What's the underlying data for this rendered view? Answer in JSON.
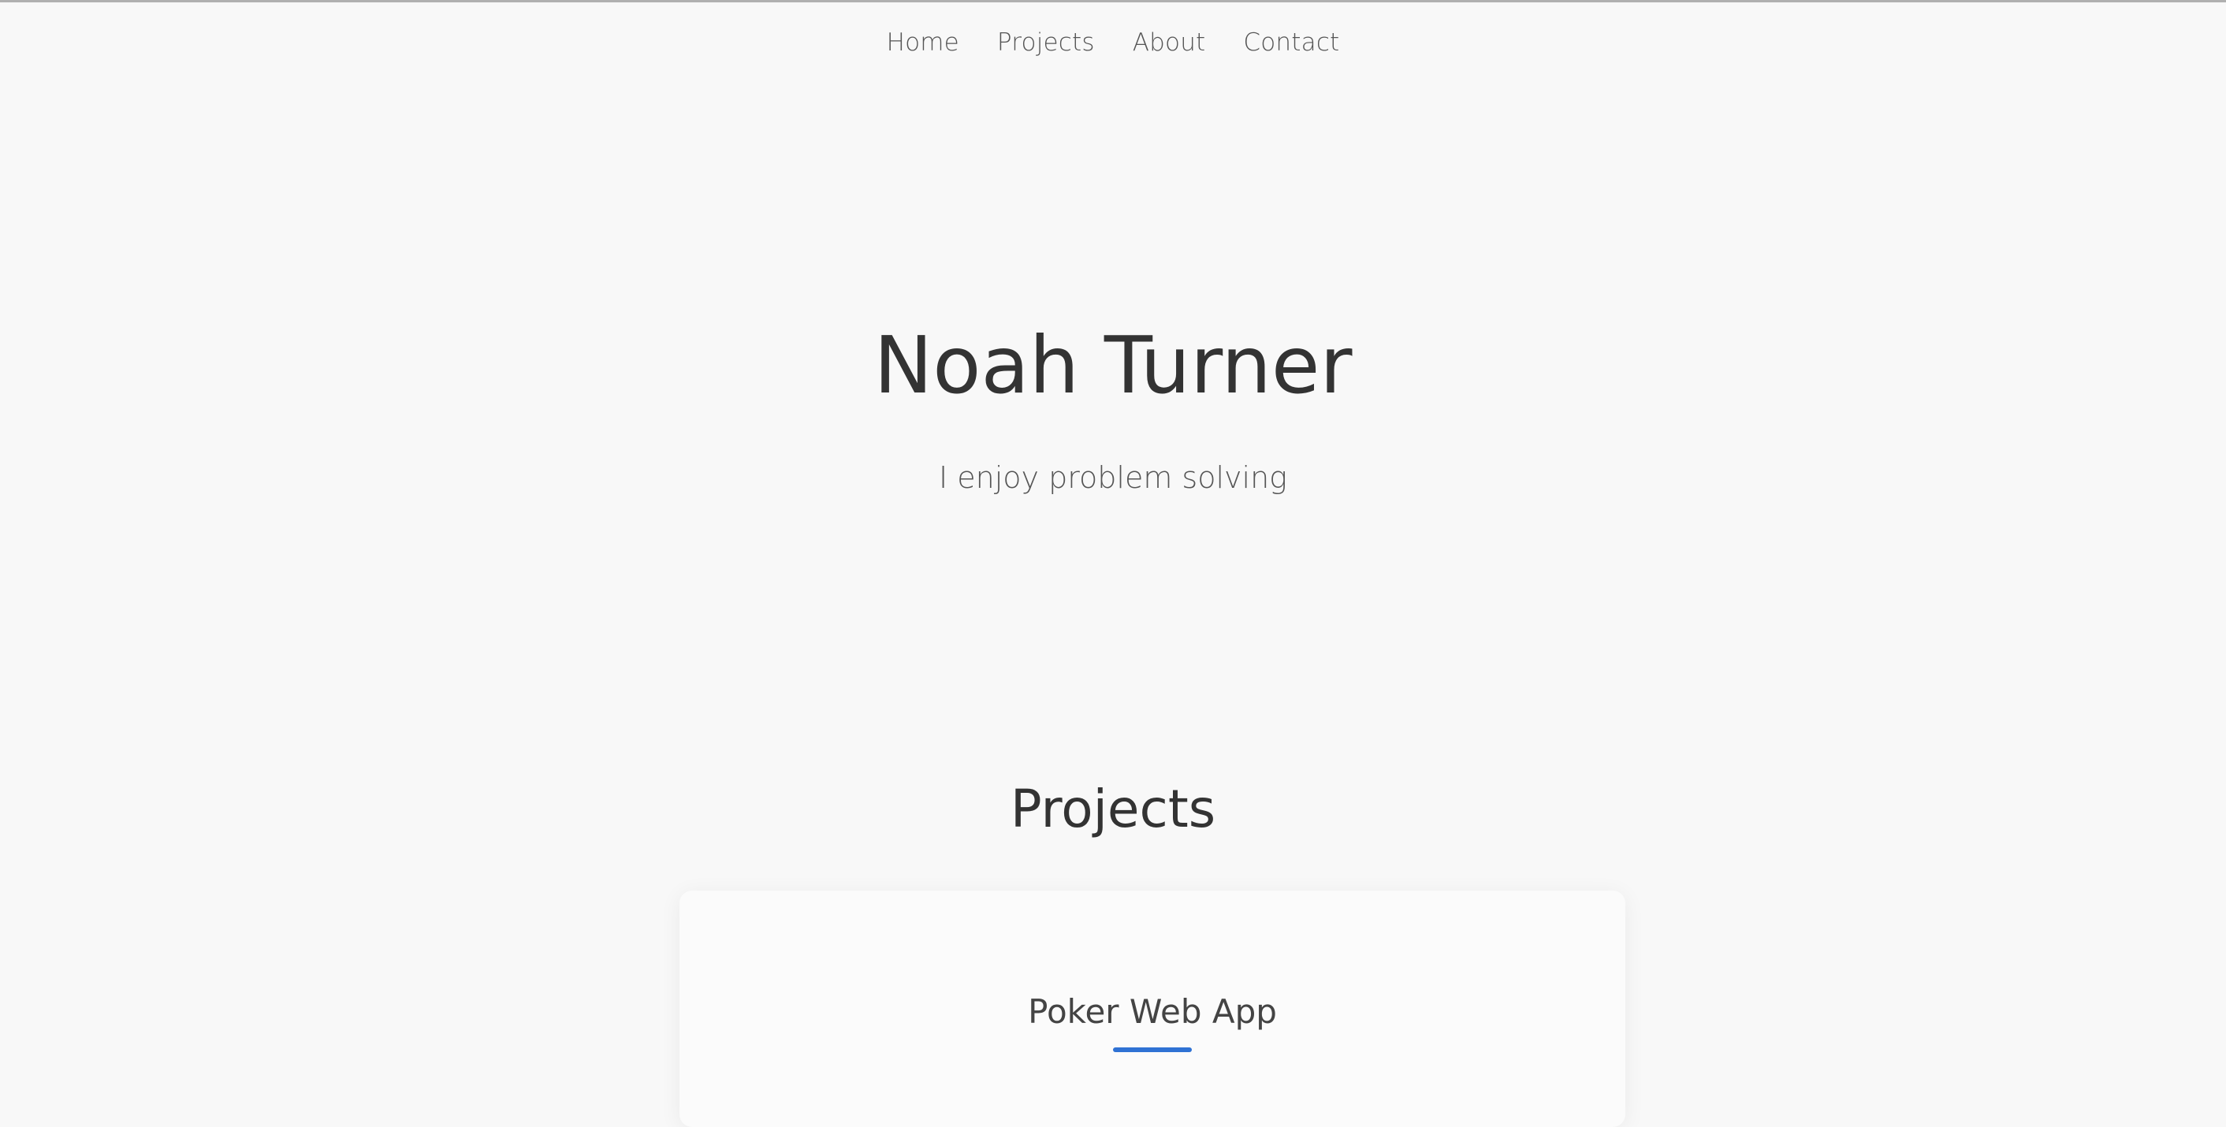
{
  "nav": {
    "items": [
      {
        "label": "Home"
      },
      {
        "label": "Projects"
      },
      {
        "label": "About"
      },
      {
        "label": "Contact"
      }
    ]
  },
  "hero": {
    "title": "Noah Turner",
    "subtitle": "I enjoy problem solving"
  },
  "projects": {
    "heading": "Projects",
    "cards": [
      {
        "title": "Poker Web App"
      }
    ]
  },
  "colors": {
    "background": "#f8f8f8",
    "text": "#333333",
    "muted_text": "#555555",
    "accent": "#2f72d4"
  }
}
